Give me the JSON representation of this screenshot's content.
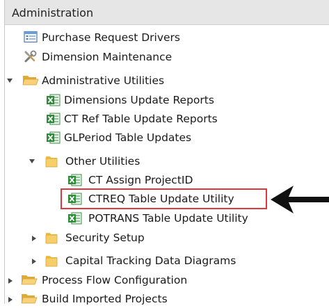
{
  "panel": {
    "title": "Administration"
  },
  "tree": {
    "purchase_request_drivers": "Purchase Request Drivers",
    "dimension_maintenance": "Dimension Maintenance",
    "administrative_utilities": "Administrative Utilities",
    "dimensions_update_reports": "Dimensions Update Reports",
    "ct_ref_table_update_reports": "CT Ref Table Update Reports",
    "glperiod_table_updates": "GLPeriod Table Updates",
    "other_utilities": "Other Utilities",
    "ct_assign_projectid": "CT Assign ProjectID",
    "ctreq_table_update_utility": "CTREQ Table Update Utility",
    "potrans_table_update_utility": "POTRANS Table Update Utility",
    "security_setup": "Security Setup",
    "capital_tracking_data_diagrams": "Capital Tracking Data Diagrams",
    "process_flow_configuration": "Process Flow Configuration",
    "build_imported_projects": "Build Imported Projects"
  },
  "colors": {
    "highlight_border": "#e0363d",
    "folder": "#f2c14e",
    "excel_green": "#2e8b3a"
  },
  "icons": {
    "form": "form-icon",
    "tools": "tools-icon",
    "folder": "folder-icon",
    "excel": "excel-report-icon",
    "arrow": "arrow-left-icon"
  }
}
